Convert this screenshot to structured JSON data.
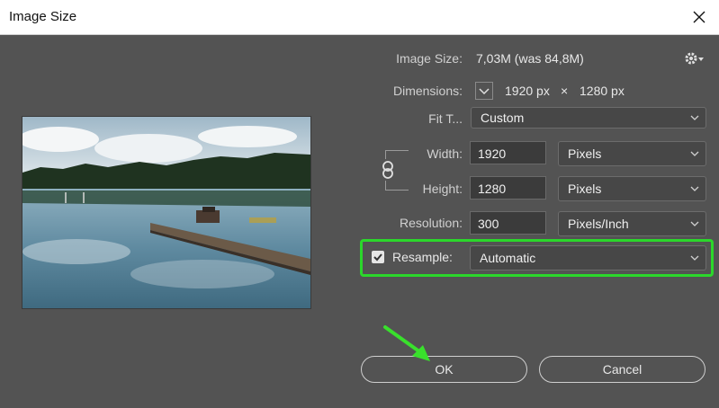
{
  "window": {
    "title": "Image Size"
  },
  "image_size": {
    "label": "Image Size:",
    "value": "7,03M (was 84,8M)"
  },
  "dimensions": {
    "label": "Dimensions:",
    "width": "1920 px",
    "times": "×",
    "height": "1280 px"
  },
  "fit_to": {
    "label": "Fit T...",
    "value": "Custom"
  },
  "width": {
    "label": "Width:",
    "value": "1920",
    "unit": "Pixels"
  },
  "height": {
    "label": "Height:",
    "value": "1280",
    "unit": "Pixels"
  },
  "resolution": {
    "label": "Resolution:",
    "value": "300",
    "unit": "Pixels/Inch"
  },
  "resample": {
    "label": "Resample:",
    "checked": true,
    "value": "Automatic"
  },
  "buttons": {
    "ok": "OK",
    "cancel": "Cancel"
  },
  "colors": {
    "dialog_bg": "#535353",
    "highlight": "#2bd72b",
    "arrow": "#39e02c"
  }
}
